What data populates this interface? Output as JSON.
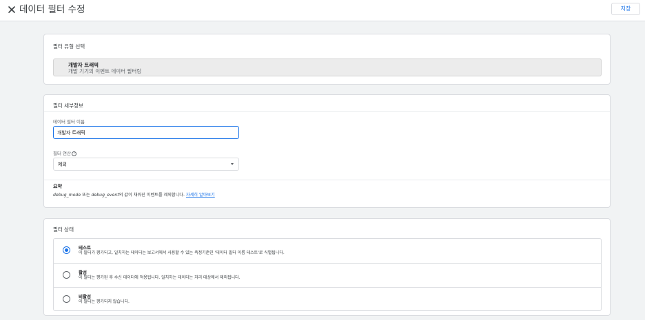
{
  "header": {
    "title": "데이터 필터 수정",
    "save_label": "저장",
    "close_icon": "close-icon"
  },
  "filter_type": {
    "heading": "필터 유형 선택",
    "selected_title": "개발자 트래픽",
    "selected_desc": "개발 기기의 이벤트 데이터 필터링"
  },
  "details": {
    "heading": "필터 세부정보",
    "name_label": "데이터 필터 이름",
    "name_value": "개발자 트래픽",
    "operation_label": "필터 연산",
    "operation_value": "제외",
    "summary_title": "요약",
    "summary_param1": "debug_mode",
    "summary_or": " 또는 ",
    "summary_param2": "debug_event",
    "summary_rest": "의 값이 채워진 이벤트를 제외합니다.",
    "learn_more": "자세히 알아보기"
  },
  "state": {
    "heading": "필터 상태",
    "options": [
      {
        "title": "테스트",
        "desc": "이 필터가 평가되고, 일치하는 데이터는 보고서에서 사용할 수 있는 측정기준인 '데이터 필터 이름 테스트'로 식별됩니다.",
        "checked": true
      },
      {
        "title": "활성",
        "desc": "이 필터는 평가된 후 수신 데이터에 적용됩니다. 일치하는 데이터는 처리 대상에서 제외됩니다.",
        "checked": false
      },
      {
        "title": "비활성",
        "desc": "이 필터는 평가되지 않습니다.",
        "checked": false
      }
    ]
  },
  "colors": {
    "accent": "#1a73e8",
    "background": "#f1f3f4"
  }
}
